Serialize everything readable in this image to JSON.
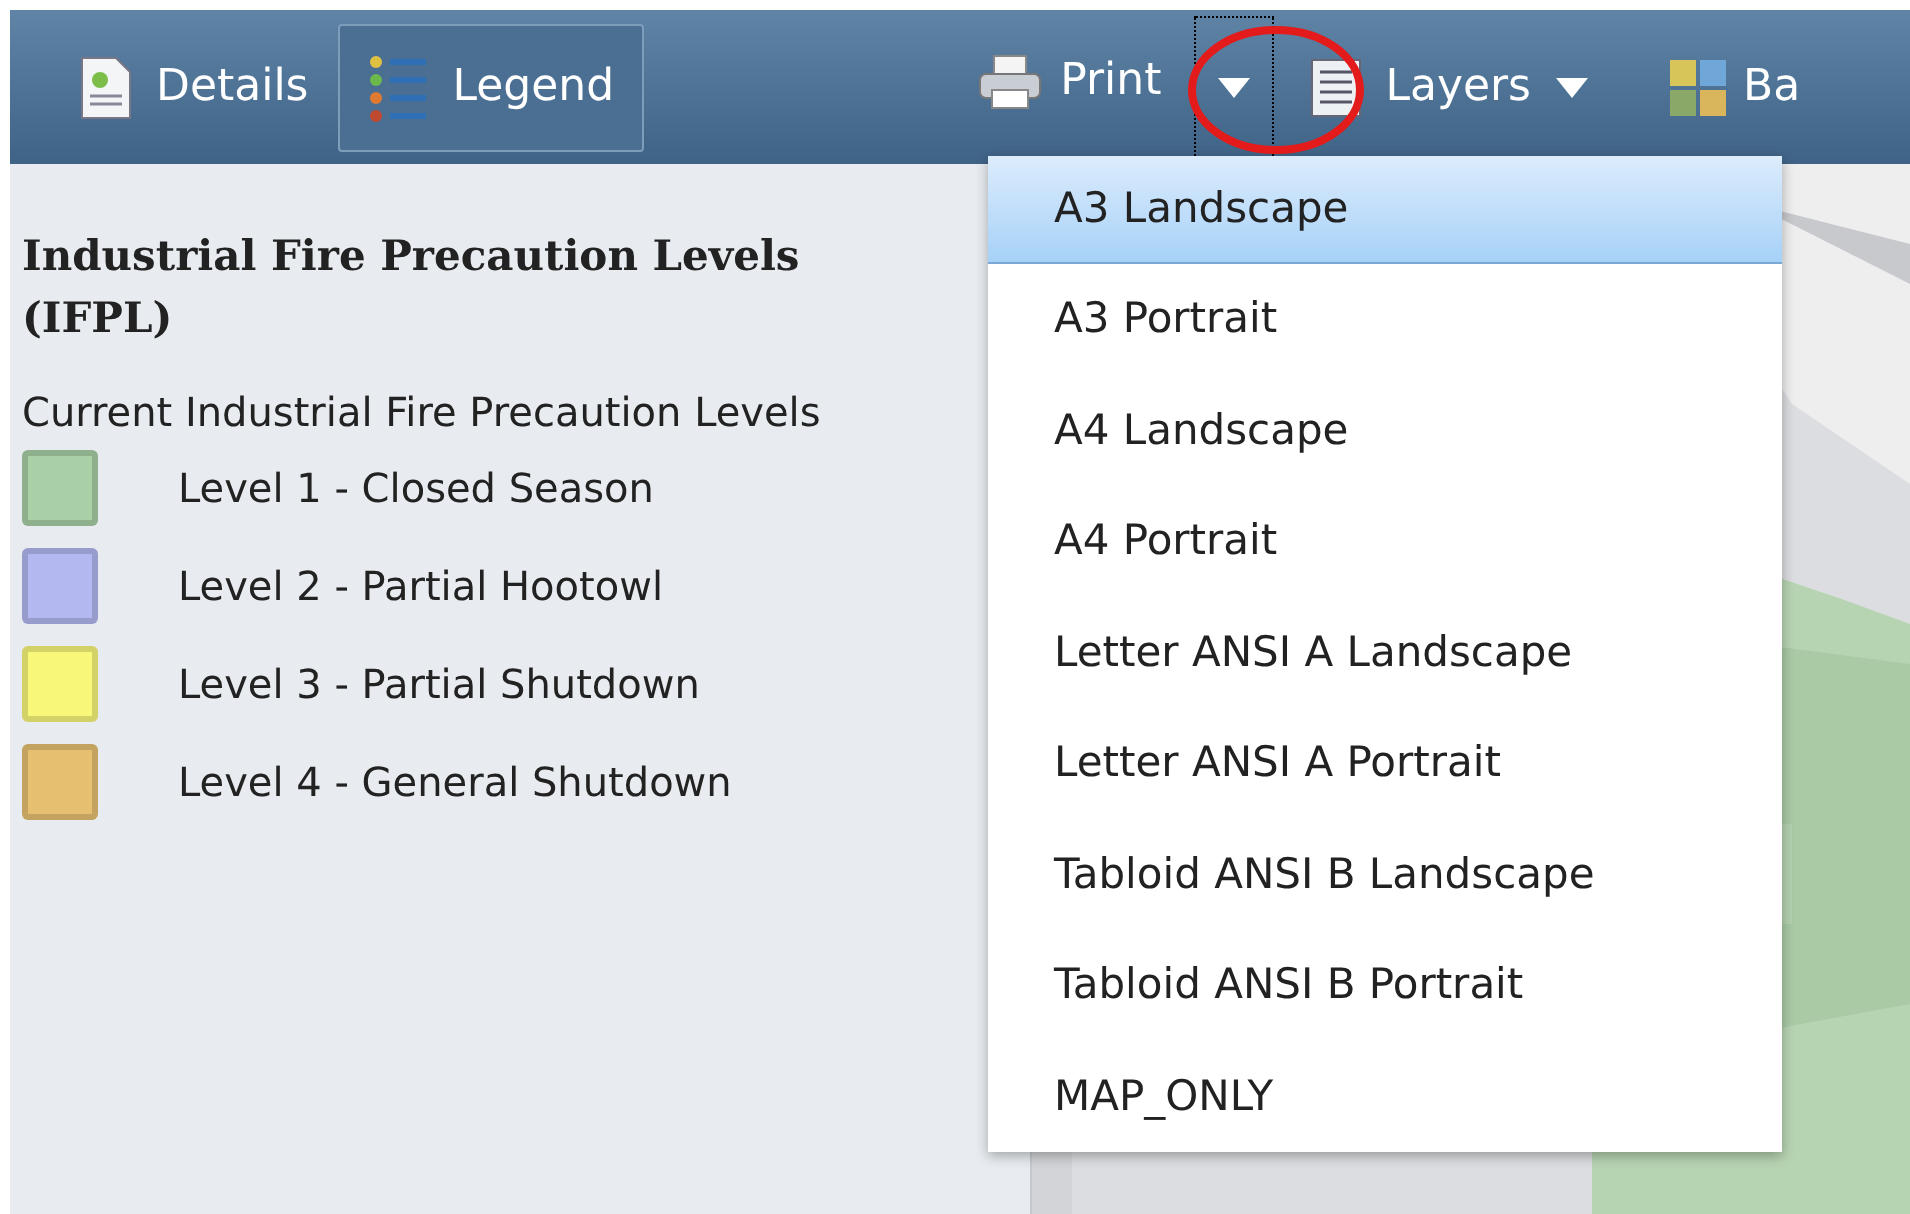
{
  "toolbar": {
    "buttons": [
      {
        "kind": "details",
        "label": "Details",
        "selected": false
      },
      {
        "kind": "legend",
        "label": "Legend",
        "selected": true
      }
    ],
    "print": {
      "label": "Print"
    },
    "layers": {
      "label": "Layers"
    },
    "basemap": {
      "label": "Ba"
    }
  },
  "legend": {
    "title": "Industrial Fire Precaution Levels (IFPL)",
    "layer": "Current Industrial Fire Precaution Levels",
    "items": [
      {
        "label": "Level 1 - Closed Season",
        "color": "#a8cfa6"
      },
      {
        "label": "Level 2 - Partial Hootowl",
        "color": "#b3b8f0"
      },
      {
        "label": "Level 3 - Partial Shutdown",
        "color": "#f8f77a"
      },
      {
        "label": "Level 4 - General Shutdown",
        "color": "#e6c070"
      }
    ]
  },
  "print_menu": {
    "items": [
      {
        "label": "A3 Landscape",
        "selected": true
      },
      {
        "label": "A3 Portrait",
        "selected": false
      },
      {
        "label": "A4 Landscape",
        "selected": false
      },
      {
        "label": "A4 Portrait",
        "selected": false
      },
      {
        "label": "Letter ANSI A Landscape",
        "selected": false
      },
      {
        "label": "Letter ANSI A Portrait",
        "selected": false
      },
      {
        "label": "Tabloid ANSI B Landscape",
        "selected": false
      },
      {
        "label": "Tabloid ANSI B Portrait",
        "selected": false
      },
      {
        "label": "MAP_ONLY",
        "selected": false
      }
    ]
  }
}
